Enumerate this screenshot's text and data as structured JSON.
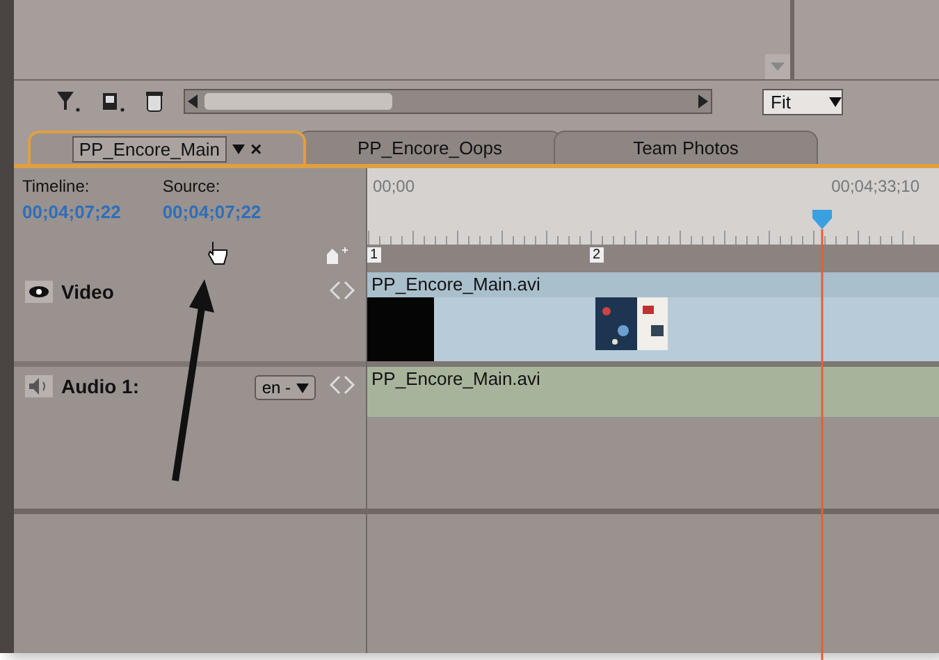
{
  "toolbar": {
    "zoom": "Fit"
  },
  "tabs": [
    {
      "label": "PP_Encore_Main",
      "selected": true,
      "close": "×"
    },
    {
      "label": "PP_Encore_Oops",
      "selected": false
    },
    {
      "label": "Team Photos",
      "selected": false
    }
  ],
  "timecodes": [
    {
      "label": "Timeline:",
      "value": "00;04;07;22"
    },
    {
      "label": "Source:",
      "value": "00;04;07;22"
    }
  ],
  "ruler": {
    "start": "00;00",
    "end": "00;04;33;10",
    "markers": [
      "1",
      "2"
    ]
  },
  "tracks": [
    {
      "kind": "video",
      "name": "Video",
      "clip": "PP_Encore_Main.avi"
    },
    {
      "kind": "audio",
      "name": "Audio 1:",
      "language": "en -",
      "clip": "PP_Encore_Main.avi"
    }
  ]
}
